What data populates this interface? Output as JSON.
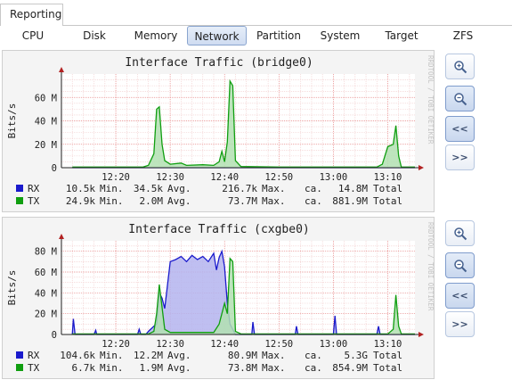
{
  "app": {
    "tab_label": "Reporting"
  },
  "subnav": {
    "items": [
      {
        "label": "CPU"
      },
      {
        "label": "Disk"
      },
      {
        "label": "Memory"
      },
      {
        "label": "Network"
      },
      {
        "label": "Partition"
      },
      {
        "label": "System"
      },
      {
        "label": "Target"
      },
      {
        "label": "ZFS"
      }
    ],
    "active": "Network"
  },
  "side_buttons": {
    "zoom_in": "zoom-in-icon",
    "zoom_out": "zoom-out-icon",
    "back": "<<",
    "forward": ">>"
  },
  "colors": {
    "rx": "#1a1acc",
    "rx_fill": "#b4b4ee",
    "tx": "#109e10",
    "tx_fill": "#b2e0b2",
    "active_tab": "#cfdcf1"
  },
  "chart_data": [
    {
      "type": "area",
      "title": "Interface Traffic (bridge0)",
      "ylabel": "Bits/s",
      "watermark": "RRDTOOL / TOBI OETIKER",
      "ylim": [
        0,
        80
      ],
      "y_ticks": [
        0,
        20,
        40,
        60
      ],
      "y_tick_labels": [
        "0",
        "20 M",
        "40 M",
        "60 M"
      ],
      "xlim": [
        "12:10",
        "13:15"
      ],
      "x_ticks": [
        "12:20",
        "12:30",
        "12:40",
        "12:50",
        "13:00",
        "13:10"
      ],
      "series": [
        {
          "name": "RX",
          "values": [
            [
              12.12,
              0.01
            ],
            [
              13.15,
              0.01
            ]
          ],
          "stats": {
            "min": "10.5k",
            "min_label": "Min.",
            "avg": "34.5k",
            "avg_label": "Avg.",
            "max": "216.7k",
            "max_label": "Max.",
            "approx": "ca.",
            "total": "14.8M",
            "total_label": "Total"
          }
        },
        {
          "name": "TX",
          "values": [
            [
              12.12,
              0.5
            ],
            [
              12.25,
              0.5
            ],
            [
              12.26,
              2
            ],
            [
              12.27,
              12
            ],
            [
              12.275,
              50
            ],
            [
              12.28,
              52
            ],
            [
              12.285,
              20
            ],
            [
              12.29,
              6
            ],
            [
              12.3,
              3
            ],
            [
              12.32,
              4
            ],
            [
              12.33,
              2
            ],
            [
              12.36,
              2.5
            ],
            [
              12.38,
              2
            ],
            [
              12.39,
              5
            ],
            [
              12.395,
              14
            ],
            [
              12.4,
              5
            ],
            [
              12.405,
              22
            ],
            [
              12.41,
              74
            ],
            [
              12.415,
              70
            ],
            [
              12.42,
              6
            ],
            [
              12.43,
              1
            ],
            [
              12.5,
              0.5
            ],
            [
              13.0,
              0.5
            ],
            [
              13.08,
              0.5
            ],
            [
              13.09,
              3
            ],
            [
              13.1,
              18
            ],
            [
              13.11,
              20
            ],
            [
              13.115,
              36
            ],
            [
              13.12,
              10
            ],
            [
              13.125,
              0.5
            ],
            [
              13.15,
              0.5
            ]
          ],
          "stats": {
            "min": "24.9k",
            "min_label": "Min.",
            "avg": "2.0M",
            "avg_label": "Avg.",
            "max": "73.7M",
            "max_label": "Max.",
            "approx": "ca.",
            "total": "881.9M",
            "total_label": "Total"
          }
        }
      ]
    },
    {
      "type": "area",
      "title": "Interface Traffic (cxgbe0)",
      "ylabel": "Bits/s",
      "watermark": "RRDTOOL / TOBI OETIKER",
      "ylim": [
        0,
        90
      ],
      "y_ticks": [
        0,
        20,
        40,
        60,
        80
      ],
      "y_tick_labels": [
        "0",
        "20 M",
        "40 M",
        "60 M",
        "80 M"
      ],
      "xlim": [
        "12:10",
        "13:15"
      ],
      "x_ticks": [
        "12:20",
        "12:30",
        "12:40",
        "12:50",
        "13:00",
        "13:10"
      ],
      "series": [
        {
          "name": "RX",
          "values": [
            [
              12.12,
              0
            ],
            [
              12.122,
              15
            ],
            [
              12.125,
              0
            ],
            [
              12.16,
              0
            ],
            [
              12.163,
              4
            ],
            [
              12.165,
              0
            ],
            [
              12.24,
              0
            ],
            [
              12.243,
              5
            ],
            [
              12.246,
              0
            ],
            [
              12.255,
              0
            ],
            [
              12.26,
              3
            ],
            [
              12.27,
              8
            ],
            [
              12.275,
              10
            ],
            [
              12.28,
              40
            ],
            [
              12.285,
              35
            ],
            [
              12.29,
              25
            ],
            [
              12.3,
              70
            ],
            [
              12.31,
              72
            ],
            [
              12.32,
              75
            ],
            [
              12.33,
              70
            ],
            [
              12.34,
              76
            ],
            [
              12.35,
              72
            ],
            [
              12.36,
              75
            ],
            [
              12.37,
              70
            ],
            [
              12.38,
              78
            ],
            [
              12.385,
              62
            ],
            [
              12.39,
              74
            ],
            [
              12.395,
              80
            ],
            [
              12.4,
              65
            ],
            [
              12.405,
              30
            ],
            [
              12.41,
              10
            ],
            [
              12.42,
              0
            ],
            [
              12.45,
              0
            ],
            [
              12.452,
              12
            ],
            [
              12.455,
              0
            ],
            [
              12.53,
              0
            ],
            [
              12.532,
              8
            ],
            [
              12.535,
              0
            ],
            [
              13.0,
              0
            ],
            [
              13.003,
              18
            ],
            [
              13.006,
              0
            ],
            [
              13.08,
              0
            ],
            [
              13.083,
              8
            ],
            [
              13.086,
              0
            ],
            [
              13.15,
              0
            ]
          ],
          "stats": {
            "min": "104.6k",
            "min_label": "Min.",
            "avg": "12.2M",
            "avg_label": "Avg.",
            "max": "80.9M",
            "max_label": "Max.",
            "approx": "ca.",
            "total": "5.3G",
            "total_label": "Total"
          }
        },
        {
          "name": "TX",
          "values": [
            [
              12.12,
              0.5
            ],
            [
              12.26,
              0.5
            ],
            [
              12.27,
              3
            ],
            [
              12.275,
              20
            ],
            [
              12.28,
              48
            ],
            [
              12.29,
              5
            ],
            [
              12.3,
              2
            ],
            [
              12.38,
              2
            ],
            [
              12.39,
              10
            ],
            [
              12.4,
              30
            ],
            [
              12.405,
              20
            ],
            [
              12.41,
              73
            ],
            [
              12.415,
              70
            ],
            [
              12.42,
              3
            ],
            [
              12.43,
              0.5
            ],
            [
              13.1,
              0.5
            ],
            [
              13.11,
              5
            ],
            [
              13.115,
              38
            ],
            [
              13.12,
              8
            ],
            [
              13.125,
              0.5
            ],
            [
              13.15,
              0.5
            ]
          ],
          "stats": {
            "min": "6.7k",
            "min_label": "Min.",
            "avg": "1.9M",
            "avg_label": "Avg.",
            "max": "73.8M",
            "max_label": "Max.",
            "approx": "ca.",
            "total": "854.9M",
            "total_label": "Total"
          }
        }
      ]
    }
  ]
}
